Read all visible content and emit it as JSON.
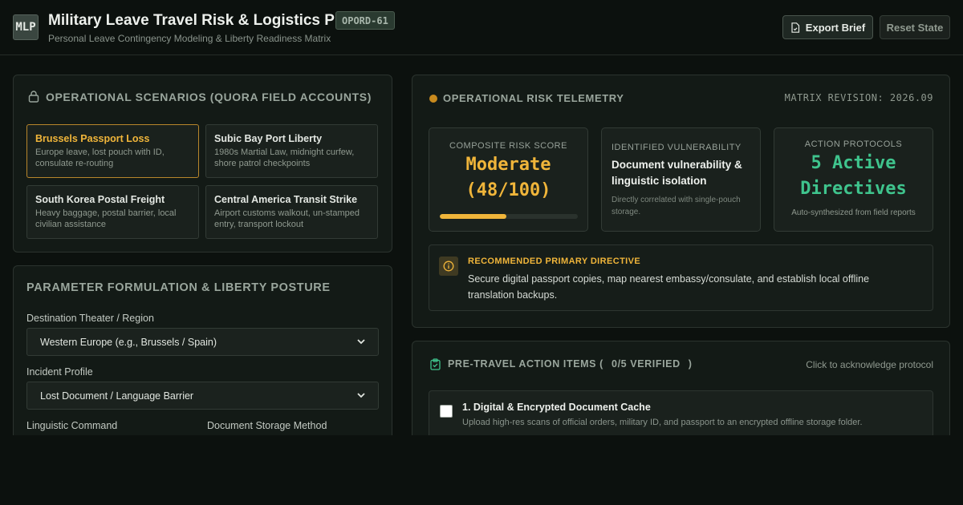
{
  "header": {
    "logo": "MLP",
    "title": "Military Leave Travel Risk & Logistics Planner",
    "badge": "OPORD-61",
    "subtitle": "Personal Leave Contingency Modeling & Liberty Readiness Matrix",
    "export_label": "Export Brief",
    "reset_label": "Reset State"
  },
  "scenarios": {
    "heading": "OPERATIONAL SCENARIOS (QUORA FIELD ACCOUNTS)",
    "items": [
      {
        "title": "Brussels Passport Loss",
        "desc": "Europe leave, lost pouch with ID, consulate re-routing",
        "active": true
      },
      {
        "title": "Subic Bay Port Liberty",
        "desc": "1980s Martial Law, midnight curfew, shore patrol checkpoints",
        "active": false
      },
      {
        "title": "South Korea Postal Freight",
        "desc": "Heavy baggage, postal barrier, local civilian assistance",
        "active": false
      },
      {
        "title": "Central America Transit Strike",
        "desc": "Airport customs walkout, un-stamped entry, transport lockout",
        "active": false
      }
    ]
  },
  "parameters": {
    "heading": "PARAMETER FORMULATION & LIBERTY POSTURE",
    "destination_label": "Destination Theater / Region",
    "destination_value": "Western Europe (e.g., Brussels / Spain)",
    "incident_label": "Incident Profile",
    "incident_value": "Lost Document / Language Barrier",
    "linguistic_label": "Linguistic Command",
    "storage_label": "Document Storage Method"
  },
  "telemetry": {
    "heading": "OPERATIONAL RISK TELEMETRY",
    "revision": "MATRIX REVISION: 2026.09",
    "risk_label": "COMPOSITE RISK SCORE",
    "risk_level": "Moderate",
    "risk_score": "(48/100)",
    "risk_fraction": 0.48,
    "vuln_label": "IDENTIFIED VULNERABILITY",
    "vuln_title": "Document vulnerability & linguistic isolation",
    "vuln_note": "Directly correlated with single-pouch storage.",
    "action_label": "ACTION PROTOCOLS",
    "action_line1": "5 Active",
    "action_line2": "Directives",
    "action_note": "Auto-synthesized from field reports",
    "directive_title": "RECOMMENDED PRIMARY DIRECTIVE",
    "directive_text": "Secure digital passport copies, map nearest embassy/consulate, and establish local offline translation backups."
  },
  "checklist": {
    "heading_prefix": "PRE-TRAVEL ACTION ITEMS (",
    "count": "0/5 VERIFIED",
    "heading_suffix": ")",
    "hint": "Click to acknowledge protocol",
    "items": [
      {
        "title": "1. Digital & Encrypted Document Cache",
        "desc": "Upload high-res scans of official orders, military ID, and passport to an encrypted offline storage folder."
      }
    ]
  },
  "colors": {
    "accent_amber": "#f0b53a",
    "accent_green": "#3fc48d",
    "background": "#0c110e"
  },
  "icons": {
    "scenarios": "lock-icon",
    "telemetry": "status-dot-icon",
    "directive": "info-icon",
    "checklist": "clipboard-check-icon",
    "export": "document-icon"
  }
}
